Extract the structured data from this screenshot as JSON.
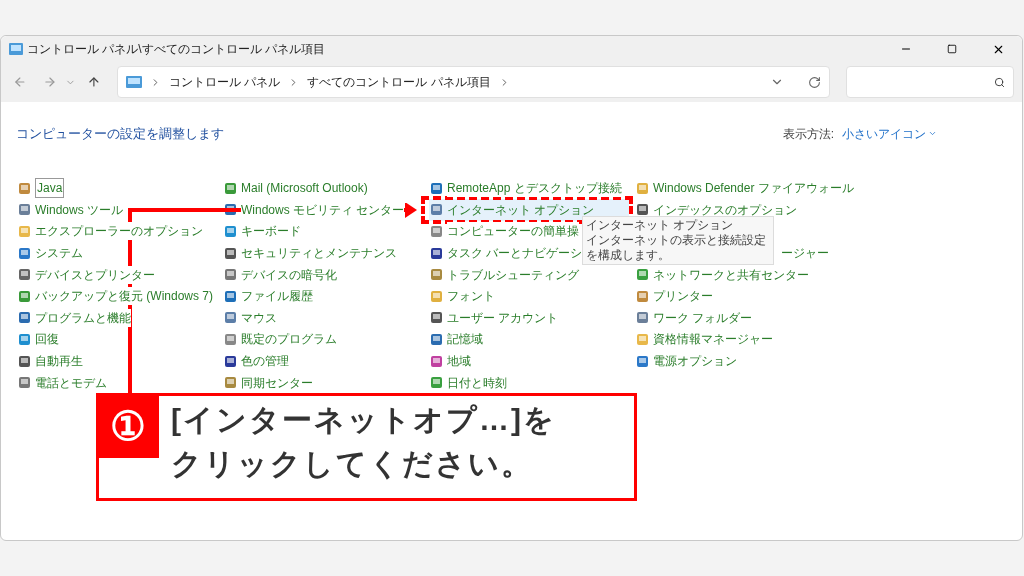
{
  "window": {
    "title": "コントロール パネル\\すべてのコントロール パネル項目"
  },
  "address": {
    "crumbs": [
      "コントロール パネル",
      "すべてのコントロール パネル項目"
    ]
  },
  "heading": "コンピューターの設定を調整します",
  "view": {
    "label": "表示方法:",
    "value": "小さいアイコン"
  },
  "columns": [
    [
      {
        "kind": "item",
        "label": "Java",
        "focused": true
      },
      {
        "kind": "item",
        "label": "Windows ツール",
        "focused": false
      },
      {
        "kind": "item",
        "label": "エクスプローラーのオプション",
        "focused": false
      },
      {
        "kind": "item",
        "label": "システム",
        "focused": false
      },
      {
        "kind": "item",
        "label": "デバイスとプリンター",
        "focused": false
      },
      {
        "kind": "item",
        "label": "バックアップと復元 (Windows 7)",
        "focused": false
      },
      {
        "kind": "item",
        "label": "プログラムと機能",
        "focused": false
      },
      {
        "kind": "item",
        "label": "回復",
        "focused": false
      },
      {
        "kind": "item",
        "label": "自動再生",
        "focused": false
      },
      {
        "kind": "item",
        "label": "電話とモデム",
        "focused": false
      }
    ],
    [
      {
        "kind": "item",
        "label": "Mail (Microsoft Outlook)",
        "focused": false
      },
      {
        "kind": "item",
        "label": "Windows モビリティ センター",
        "focused": false
      },
      {
        "kind": "item",
        "label": "キーボード",
        "focused": false
      },
      {
        "kind": "item",
        "label": "セキュリティとメンテナンス",
        "focused": false
      },
      {
        "kind": "item",
        "label": "デバイスの暗号化",
        "focused": false
      },
      {
        "kind": "item",
        "label": "ファイル履歴",
        "focused": false
      },
      {
        "kind": "item",
        "label": "マウス",
        "focused": false
      },
      {
        "kind": "item",
        "label": "既定のプログラム",
        "focused": false
      },
      {
        "kind": "item",
        "label": "色の管理",
        "focused": false
      },
      {
        "kind": "item",
        "label": "同期センター",
        "focused": false
      }
    ],
    [
      {
        "kind": "item",
        "label": "RemoteApp とデスクトップ接続",
        "focused": false
      },
      {
        "kind": "item",
        "label": "インターネット オプション",
        "focused": false,
        "selected": true
      },
      {
        "kind": "item",
        "label": "コンピューターの簡単操",
        "focused": false
      },
      {
        "kind": "item",
        "label": "タスク バーとナビゲーシ",
        "focused": false
      },
      {
        "kind": "item",
        "label": "トラブルシューティング",
        "focused": false
      },
      {
        "kind": "item",
        "label": "フォント",
        "focused": false
      },
      {
        "kind": "item",
        "label": "ユーザー アカウント",
        "focused": false
      },
      {
        "kind": "item",
        "label": "記憶域",
        "focused": false
      },
      {
        "kind": "item",
        "label": "地域",
        "focused": false
      },
      {
        "kind": "item",
        "label": "日付と時刻",
        "focused": false
      }
    ],
    [
      {
        "kind": "item",
        "label": "Windows Defender ファイアウォール",
        "focused": false
      },
      {
        "kind": "item",
        "label": "インデックスのオプション",
        "focused": false
      },
      {
        "kind": "covered"
      },
      {
        "kind": "partial",
        "label": "ージャー"
      },
      {
        "kind": "item",
        "label": "ネットワークと共有センター",
        "focused": false
      },
      {
        "kind": "item",
        "label": "プリンター",
        "focused": false
      },
      {
        "kind": "item",
        "label": "ワーク フォルダー",
        "focused": false
      },
      {
        "kind": "item",
        "label": "資格情報マネージャー",
        "focused": false
      },
      {
        "kind": "item",
        "label": "電源オプション",
        "focused": false
      }
    ]
  ],
  "tooltip": {
    "title": "インターネット オプション",
    "text": "インターネットの表示と接続設定を構成します。"
  },
  "callout": {
    "number": "①",
    "lines": [
      "[インターネットオプ…]を",
      "クリックしてください。"
    ]
  }
}
